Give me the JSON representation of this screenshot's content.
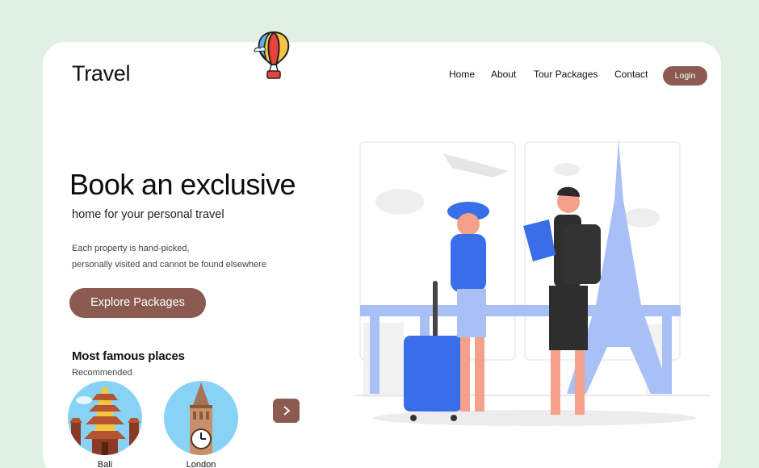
{
  "header": {
    "logo": "Travel",
    "nav": [
      {
        "label": "Home"
      },
      {
        "label": "About"
      },
      {
        "label": "Tour Packages"
      },
      {
        "label": "Contact"
      }
    ],
    "login_label": "Login"
  },
  "hero": {
    "title": "Book an exclusive",
    "subtitle": "home for your personal travel",
    "description_line1": "Each property is hand-picked,",
    "description_line2": "personally visited and cannot be found elsewhere",
    "cta_label": "Explore Packages"
  },
  "places": {
    "heading": "Most famous places",
    "subheading": "Recommended",
    "items": [
      {
        "name": "Bali",
        "icon": "temple-icon"
      },
      {
        "name": "London",
        "icon": "big-ben-icon"
      }
    ],
    "next_icon": "chevron-right-icon"
  },
  "colors": {
    "background": "#e0f0e5",
    "accent": "#8b5a50",
    "illustration_blue": "#3a6ee8",
    "illustration_light_blue": "#a9c0f6"
  }
}
